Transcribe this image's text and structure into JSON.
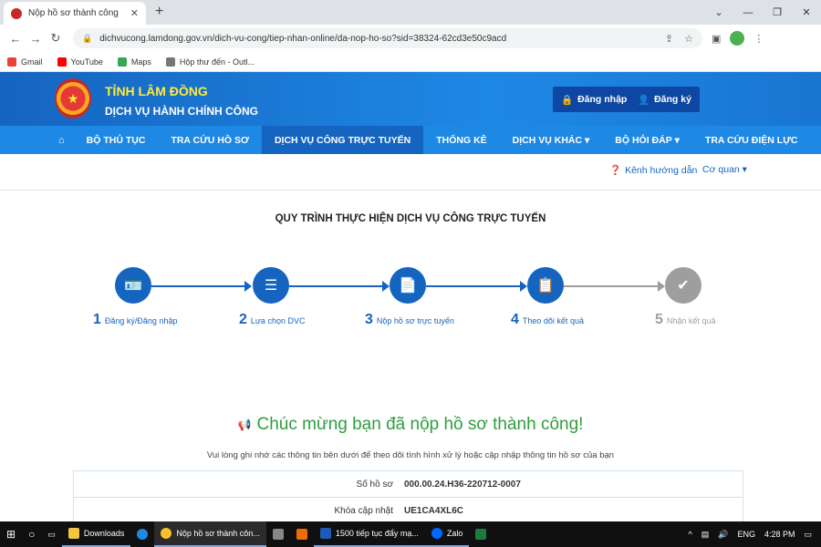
{
  "browser": {
    "tab_title": "Nộp hồ sơ thành công",
    "url": "dichvucong.lamdong.gov.vn/dich-vu-cong/tiep-nhan-online/da-nop-ho-so?sid=38324-62cd3e50c9acd",
    "bookmarks": [
      {
        "label": "Gmail",
        "color": "#ea4335"
      },
      {
        "label": "YouTube",
        "color": "#ff0000"
      },
      {
        "label": "Maps",
        "color": "#34a853"
      },
      {
        "label": "Hộp thư đến - Outl...",
        "color": "#555555"
      }
    ]
  },
  "header": {
    "brand_top": "TỈNH LÂM ĐỒNG",
    "brand_bottom": "DỊCH VỤ HÀNH CHÍNH CÔNG",
    "login": "Đăng nhập",
    "register": "Đăng ký"
  },
  "nav": {
    "items": [
      {
        "label": "BỘ THỦ TỤC"
      },
      {
        "label": "TRA CỨU HỒ SƠ"
      },
      {
        "label": "DỊCH VỤ CÔNG TRỰC TUYẾN"
      },
      {
        "label": "THỐNG KÊ"
      },
      {
        "label": "DỊCH VỤ KHÁC"
      },
      {
        "label": "BỘ HỎI ĐÁP"
      },
      {
        "label": "TRA CỨU ĐIỆN LỰC"
      }
    ]
  },
  "subbar": {
    "guide": "Kênh hướng dẫn",
    "agency": "Cơ quan"
  },
  "process": {
    "title": "QUY TRÌNH THỰC HIỆN DỊCH VỤ CÔNG TRỰC TUYẾN",
    "steps": [
      {
        "num": "1",
        "label": "Đăng ký/Đăng nhập"
      },
      {
        "num": "2",
        "label": "Lựa chọn DVC"
      },
      {
        "num": "3",
        "label": "Nộp hồ sơ trực tuyến"
      },
      {
        "num": "4",
        "label": "Theo dõi kết quả"
      },
      {
        "num": "5",
        "label": "Nhận kết quả"
      }
    ]
  },
  "result": {
    "message": "Chúc mừng bạn đã nộp hồ sơ thành công!",
    "note": "Vui lòng ghi nhớ các thông tin bên dưới để theo dõi tình hình xử lý hoặc cập nhập thông tin hồ sơ của bạn",
    "rows": [
      {
        "key": "Số hồ sơ",
        "value": "000.00.24.H36-220712-0007"
      },
      {
        "key": "Khóa cập nhật",
        "value": "UE1CA4XL6C"
      }
    ]
  },
  "taskbar": {
    "downloads": "Downloads",
    "chrome": "Nộp hồ sơ thành côn...",
    "word": "1500 tiếp tục đẩy mạ...",
    "zalo": "Zalo",
    "lang": "ENG",
    "time": "4:28 PM"
  },
  "colors": {
    "primary": "#1565c0",
    "success": "#2e9e3e",
    "brand_yellow": "#ffeb3b"
  }
}
